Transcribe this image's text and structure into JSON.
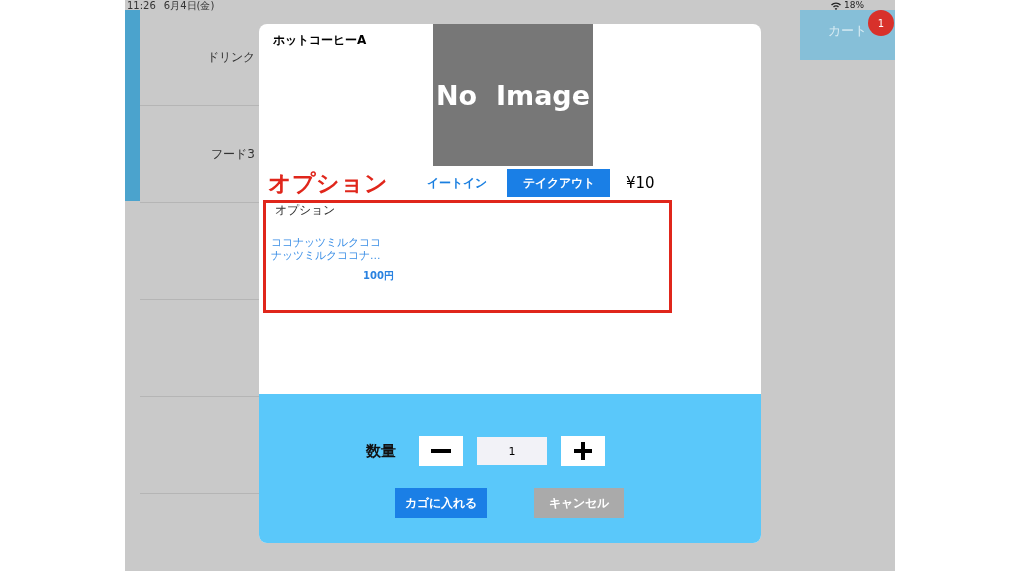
{
  "status_bar": {
    "time": "11:26",
    "date": "6月4日(金)",
    "battery": "18%"
  },
  "sidebar": {
    "items": [
      {
        "label": "ドリンク"
      },
      {
        "label": "フード3"
      }
    ]
  },
  "cart": {
    "label": "カート",
    "badge": "1"
  },
  "dialog": {
    "title": "ホットコーヒーA",
    "image_text": "No  Image",
    "annotation": "オプション",
    "tabs": [
      {
        "label": "イートイン",
        "selected": false
      },
      {
        "label": "テイクアウト",
        "selected": true
      }
    ],
    "price": "¥10",
    "options": {
      "heading": "オプション",
      "items": [
        {
          "name": "ココナッツミルクココナッツミルクココナ…",
          "price": "100円"
        }
      ]
    },
    "quantity": {
      "label": "数量",
      "value": "1"
    },
    "buttons": [
      {
        "label": "カゴに入れる",
        "kind": "primary"
      },
      {
        "label": "キャンセル",
        "kind": "secondary"
      }
    ]
  }
}
